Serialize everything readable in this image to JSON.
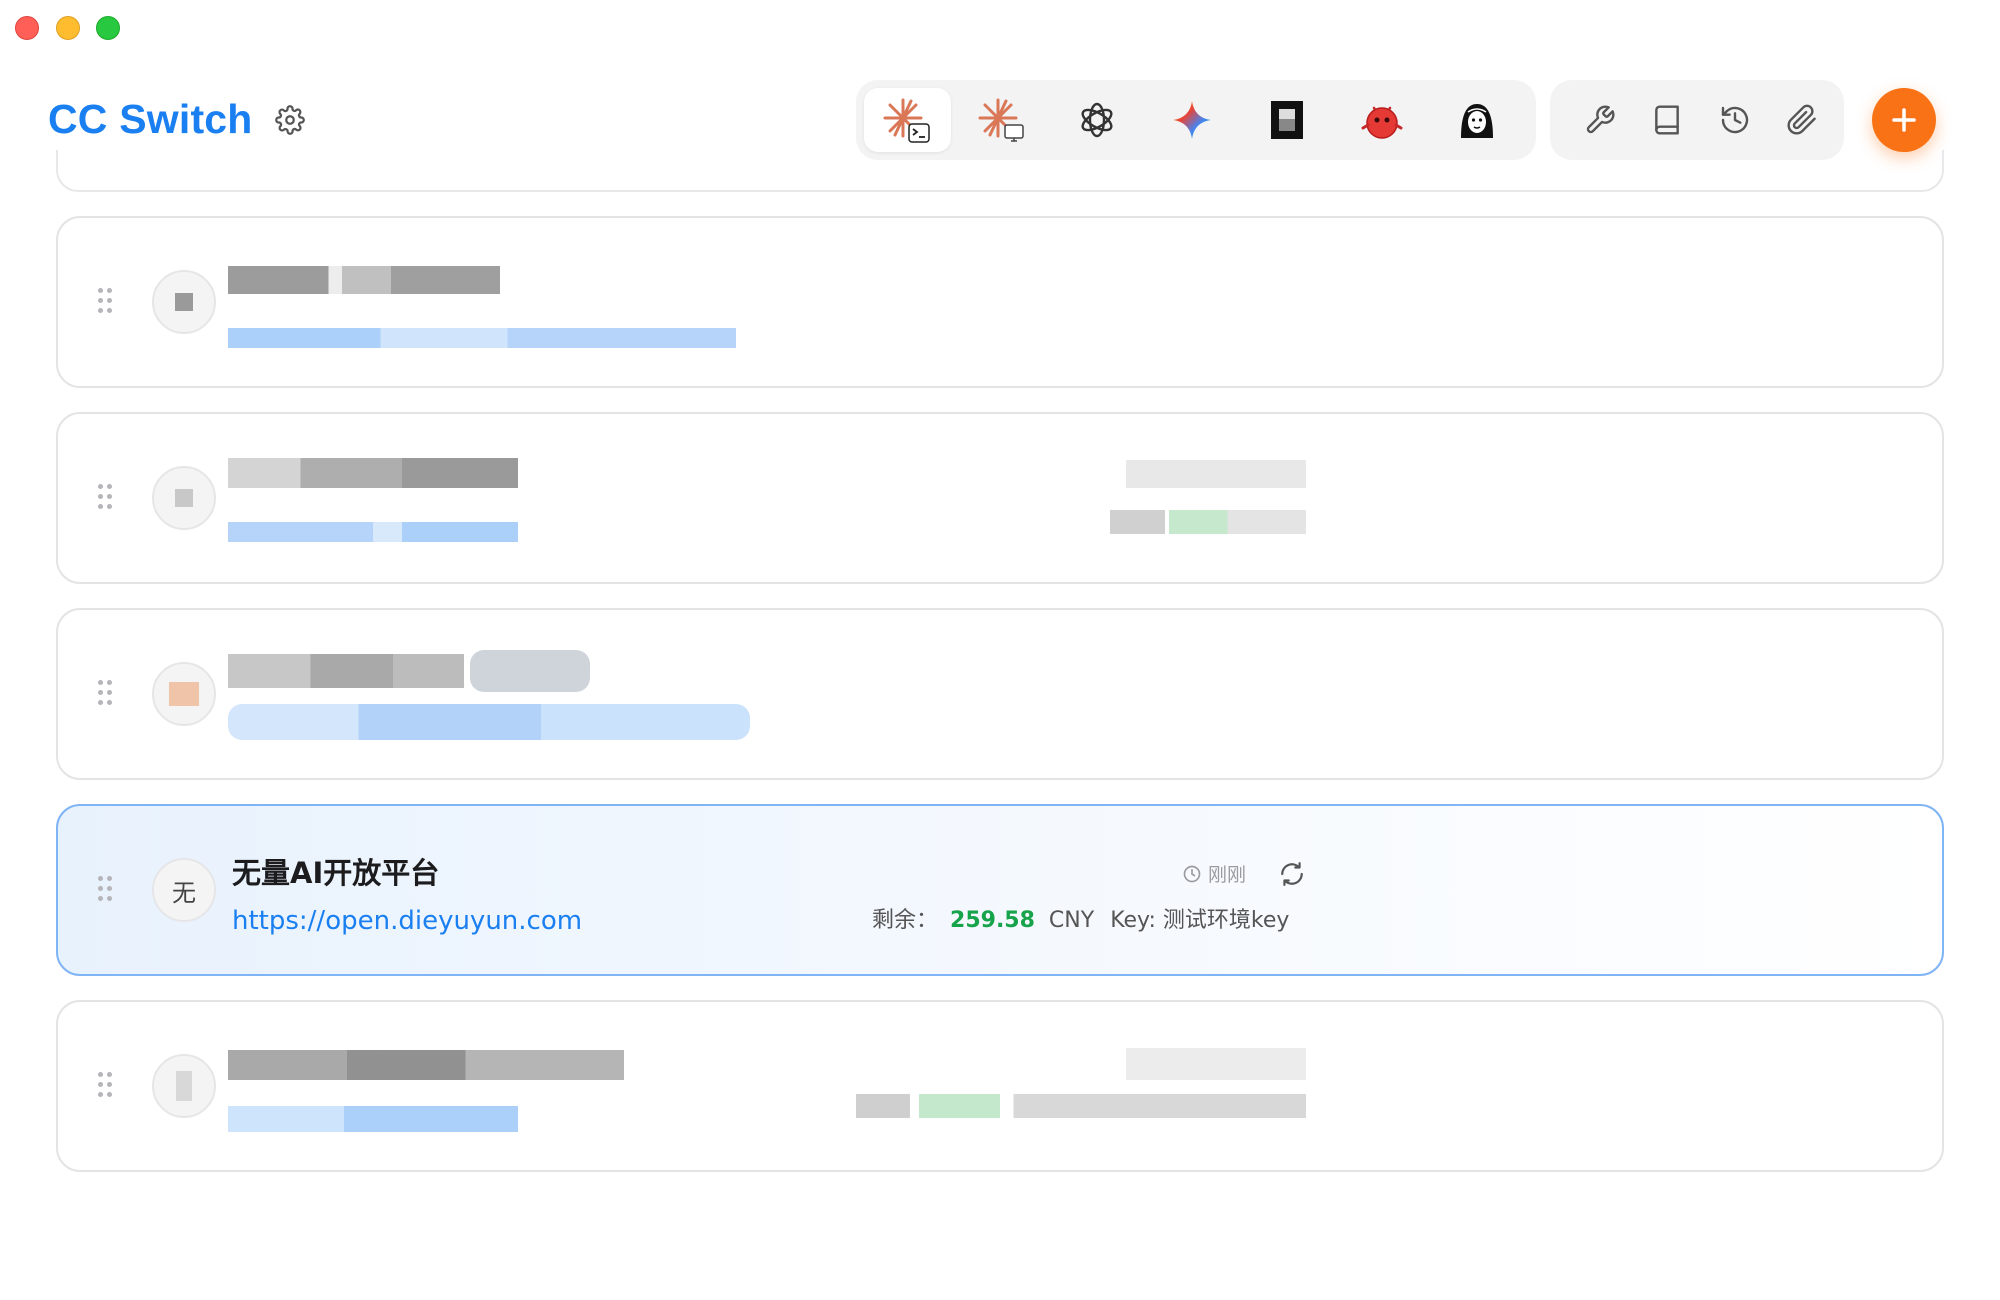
{
  "window": {
    "controls": [
      "close",
      "minimize",
      "zoom"
    ]
  },
  "header": {
    "title": "CC Switch",
    "settings_icon": "gear-icon",
    "apps": [
      {
        "icon": "claude-code-icon",
        "active": true
      },
      {
        "icon": "claude-desktop-icon",
        "active": false
      },
      {
        "icon": "openai-icon",
        "active": false
      },
      {
        "icon": "gemini-icon",
        "active": false
      },
      {
        "icon": "opencode-icon",
        "active": false
      },
      {
        "icon": "red-mascot-icon",
        "active": false
      },
      {
        "icon": "character-avatar-icon",
        "active": false
      }
    ],
    "tools": [
      "wrench-icon",
      "book-icon",
      "history-icon",
      "paperclip-icon"
    ],
    "add_icon": "plus-icon",
    "accent_color": "#1a7ff0",
    "add_color": "#f97316"
  },
  "providers": [
    {
      "pixelated": true
    },
    {
      "pixelated": true
    },
    {
      "pixelated": true
    },
    {
      "active": true,
      "avatar": "无",
      "name": "无量AI开放平台",
      "url": "https://open.dieyuyun.com",
      "updated": "刚刚",
      "balance_label": "剩余：",
      "balance_value": "259.58",
      "currency": "CNY",
      "key_label": "Key: 测试环境key"
    },
    {
      "pixelated": true
    }
  ],
  "colors": {
    "balance": "#16a34a",
    "active_border": "#7fb4f5"
  }
}
